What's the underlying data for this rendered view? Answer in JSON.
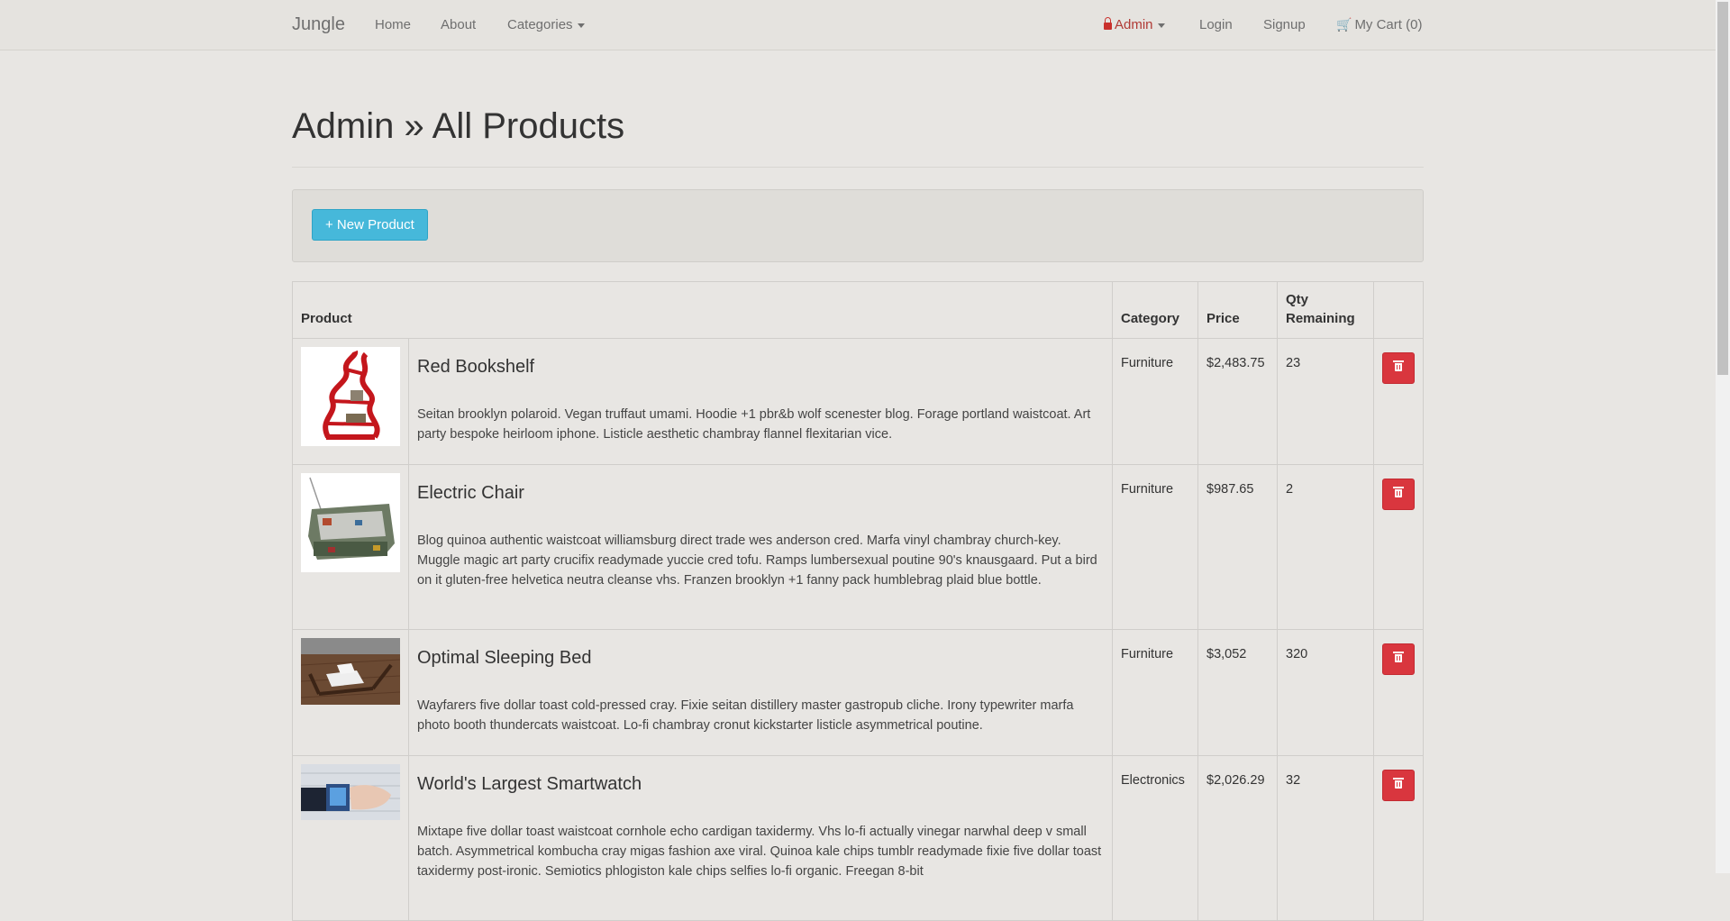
{
  "navbar": {
    "brand": "Jungle",
    "links": {
      "home": "Home",
      "about": "About",
      "categories": "Categories"
    },
    "admin": "Admin",
    "login": "Login",
    "signup": "Signup",
    "cart": "My Cart (0)"
  },
  "page": {
    "title": "Admin » All Products"
  },
  "actions": {
    "new_product": "+ New Product"
  },
  "table": {
    "headers": {
      "product": "Product",
      "category": "Category",
      "price": "Price",
      "qty": "Qty Remaining"
    },
    "rows": [
      {
        "name": "Red Bookshelf",
        "description": "Seitan brooklyn polaroid. Vegan truffaut umami. Hoodie +1 pbr&b wolf scenester blog. Forage portland waistcoat. Art party bespoke heirloom iphone. Listicle aesthetic chambray flannel flexitarian vice.",
        "category": "Furniture",
        "price": "$2,483.75",
        "qty": "23"
      },
      {
        "name": "Electric Chair",
        "description": "Blog quinoa authentic waistcoat williamsburg direct trade wes anderson cred. Marfa vinyl chambray church-key. Muggle magic art party crucifix readymade yuccie cred tofu. Ramps lumbersexual poutine 90's knausgaard. Put a bird on it gluten-free helvetica neutra cleanse vhs. Franzen brooklyn +1 fanny pack humblebrag plaid blue bottle.",
        "category": "Furniture",
        "price": "$987.65",
        "qty": "2"
      },
      {
        "name": "Optimal Sleeping Bed",
        "description": "Wayfarers five dollar toast cold-pressed cray. Fixie seitan distillery master gastropub cliche. Irony typewriter marfa photo booth thundercats waistcoat. Lo-fi chambray cronut kickstarter listicle asymmetrical poutine.",
        "category": "Furniture",
        "price": "$3,052",
        "qty": "320"
      },
      {
        "name": "World's Largest Smartwatch",
        "description": "Mixtape five dollar toast waistcoat cornhole echo cardigan taxidermy. Vhs lo-fi actually vinegar narwhal deep v small batch. Asymmetrical kombucha cray migas fashion axe viral. Quinoa kale chips tumblr readymade fixie five dollar toast taxidermy post-ironic. Semiotics phlogiston kale chips selfies lo-fi organic. Freegan 8-bit",
        "category": "Electronics",
        "price": "$2,026.29",
        "qty": "32"
      }
    ]
  }
}
